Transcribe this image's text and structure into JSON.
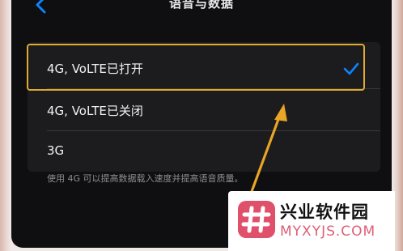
{
  "nav": {
    "title": "语音与数据",
    "back_icon": "chevron-left-icon"
  },
  "options": [
    {
      "label": "4G, VoLTE已打开",
      "selected": true
    },
    {
      "label": "4G, VoLTE已关闭",
      "selected": false
    },
    {
      "label": "3G",
      "selected": false
    }
  ],
  "footnote": "使用 4G 可以提高数据载入速度并提高语音质量。",
  "colors": {
    "accent": "#0a84ff",
    "highlight": "#e0ac2e",
    "background": "#0f0f11",
    "group": "#1c1c1e"
  },
  "watermark": {
    "name": "兴业软件园",
    "url": "MYXYJS.COM"
  }
}
